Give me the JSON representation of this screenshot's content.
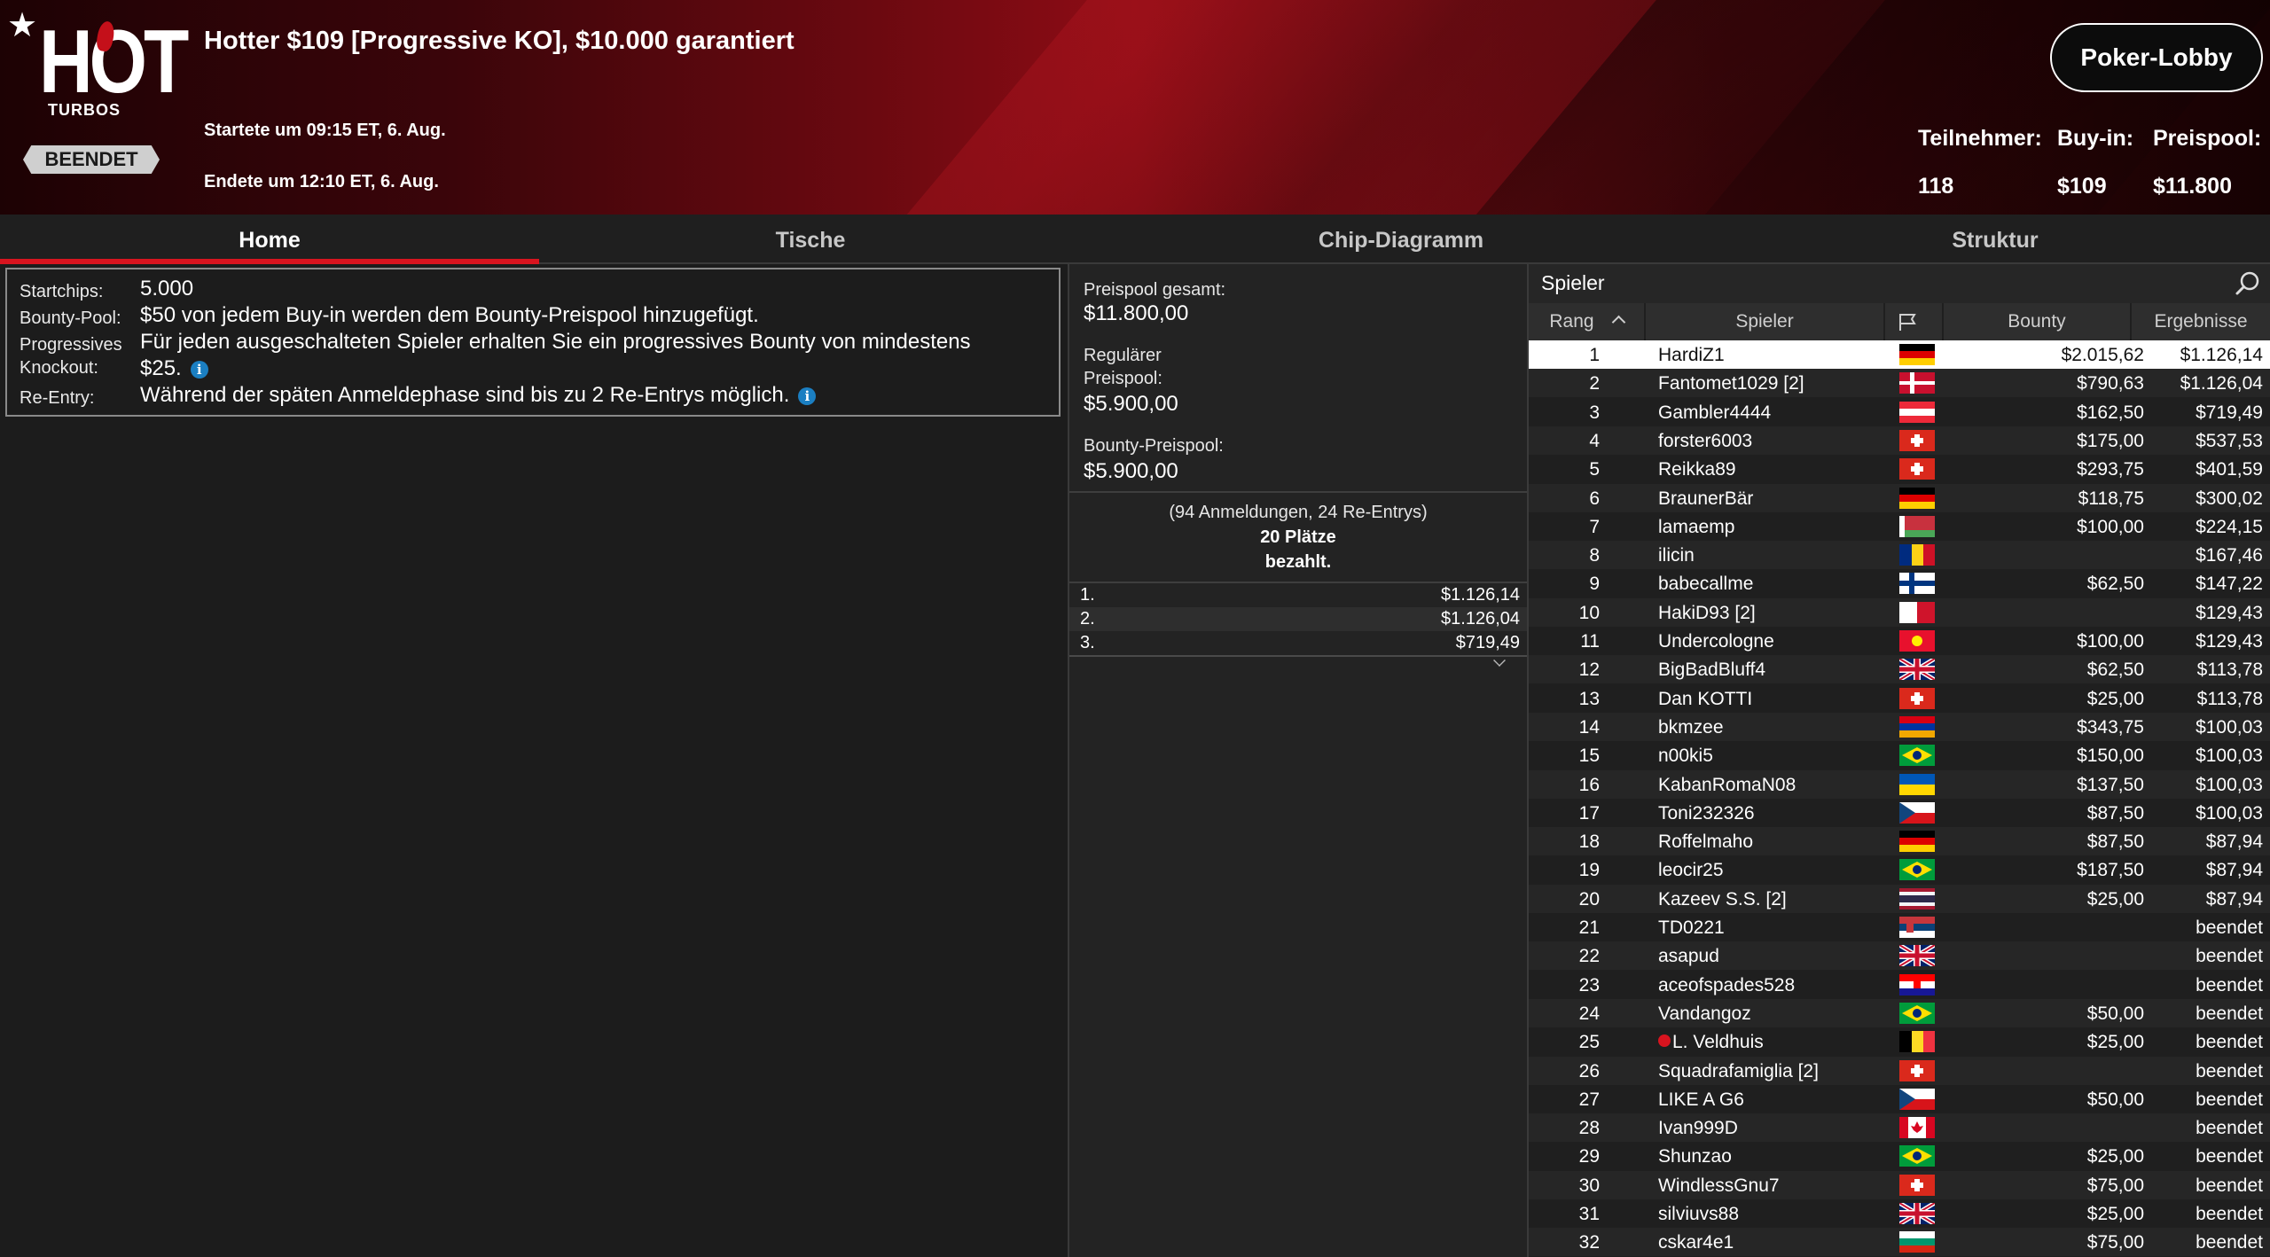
{
  "header": {
    "title": "Hotter $109 [Progressive KO], $10.000 garantiert",
    "started": "Startete um 09:15 ET, 6. Aug.",
    "ended": "Endete um 12:10 ET, 6. Aug.",
    "status": "BEENDET",
    "logo_text": "HOT",
    "logo_sub": "TURBOS",
    "lobby_button": "Poker-Lobby",
    "stats": {
      "participants_label": "Teilnehmer:",
      "participants_value": "118",
      "buyin_label": "Buy-in:",
      "buyin_value": "$109",
      "prizepool_label": "Preispool:",
      "prizepool_value": "$11.800"
    }
  },
  "tabs": [
    "Home",
    "Tische",
    "Chip-Diagramm",
    "Struktur"
  ],
  "active_tab": "Home",
  "info": {
    "startchips_label": "Startchips:",
    "startchips_value": "5.000",
    "bountypool_label": "Bounty-Pool:",
    "bountypool_value": "$50 von jedem Buy-in werden dem Bounty-Preispool hinzugefügt.",
    "pko_label_1": "Progressives",
    "pko_label_2": "Knockout:",
    "pko_value_1": "Für jeden ausgeschalteten Spieler erhalten Sie ein progressives Bounty von mindestens",
    "pko_value_2": "$25.",
    "reentry_label": "Re-Entry:",
    "reentry_value": "Während der späten Anmeldephase sind bis zu 2 Re-Entrys möglich."
  },
  "prizes": {
    "total_label": "Preispool gesamt:",
    "total_value": "$11.800,00",
    "regular_label_1": "Regulärer",
    "regular_label_2": "Preispool:",
    "regular_value": "$5.900,00",
    "bounty_label": "Bounty-Preispool:",
    "bounty_value": "$5.900,00",
    "registrations": "(94 Anmeldungen, 24 Re-Entrys)",
    "places_paid_1": "20 Plätze",
    "places_paid_2": "bezahlt.",
    "payouts": [
      {
        "pos": "1.",
        "amount": "$1.126,14"
      },
      {
        "pos": "2.",
        "amount": "$1.126,04"
      },
      {
        "pos": "3.",
        "amount": "$719,49"
      }
    ]
  },
  "players": {
    "title": "Spieler",
    "columns": [
      "Rang",
      "Spieler",
      "",
      "Bounty",
      "Ergebnisse"
    ],
    "rows": [
      {
        "rank": "1",
        "name": "HardiZ1",
        "flag": "de",
        "bounty": "$2.015,62",
        "result": "$1.126,14"
      },
      {
        "rank": "2",
        "name": "Fantomet1029 [2]",
        "flag": "dk",
        "bounty": "$790,63",
        "result": "$1.126,04"
      },
      {
        "rank": "3",
        "name": "Gambler4444",
        "flag": "at",
        "bounty": "$162,50",
        "result": "$719,49"
      },
      {
        "rank": "4",
        "name": "forster6003",
        "flag": "ch",
        "bounty": "$175,00",
        "result": "$537,53"
      },
      {
        "rank": "5",
        "name": "Reikka89",
        "flag": "ch",
        "bounty": "$293,75",
        "result": "$401,59"
      },
      {
        "rank": "6",
        "name": "BraunerBär",
        "flag": "de",
        "bounty": "$118,75",
        "result": "$300,02"
      },
      {
        "rank": "7",
        "name": "lamaemp",
        "flag": "by",
        "bounty": "$100,00",
        "result": "$224,15"
      },
      {
        "rank": "8",
        "name": "ilicin",
        "flag": "ro",
        "bounty": "",
        "result": "$167,46"
      },
      {
        "rank": "9",
        "name": "babecallme",
        "flag": "fi",
        "bounty": "$62,50",
        "result": "$147,22"
      },
      {
        "rank": "10",
        "name": "HakiD93 [2]",
        "flag": "mt",
        "bounty": "",
        "result": "$129,43"
      },
      {
        "rank": "11",
        "name": "Undercologne",
        "flag": "kg",
        "bounty": "$100,00",
        "result": "$129,43"
      },
      {
        "rank": "12",
        "name": "BigBadBluff4",
        "flag": "gb",
        "bounty": "$62,50",
        "result": "$113,78"
      },
      {
        "rank": "13",
        "name": "Dan KOTTI",
        "flag": "ch",
        "bounty": "$25,00",
        "result": "$113,78"
      },
      {
        "rank": "14",
        "name": "bkmzee",
        "flag": "am",
        "bounty": "$343,75",
        "result": "$100,03"
      },
      {
        "rank": "15",
        "name": "n00ki5",
        "flag": "br",
        "bounty": "$150,00",
        "result": "$100,03"
      },
      {
        "rank": "16",
        "name": "KabanRomaN08",
        "flag": "ua",
        "bounty": "$137,50",
        "result": "$100,03"
      },
      {
        "rank": "17",
        "name": "Toni232326",
        "flag": "cz",
        "bounty": "$87,50",
        "result": "$100,03"
      },
      {
        "rank": "18",
        "name": "Roffelmaho",
        "flag": "de",
        "bounty": "$87,50",
        "result": "$87,94"
      },
      {
        "rank": "19",
        "name": "leocir25",
        "flag": "br",
        "bounty": "$187,50",
        "result": "$87,94"
      },
      {
        "rank": "20",
        "name": "Kazeev S.S. [2]",
        "flag": "th",
        "bounty": "$25,00",
        "result": "$87,94"
      },
      {
        "rank": "21",
        "name": "TD0221",
        "flag": "rs",
        "bounty": "",
        "result": "beendet"
      },
      {
        "rank": "22",
        "name": "asapud",
        "flag": "gb",
        "bounty": "",
        "result": "beendet"
      },
      {
        "rank": "23",
        "name": "aceofspades528",
        "flag": "hr",
        "bounty": "",
        "result": "beendet"
      },
      {
        "rank": "24",
        "name": "Vandangoz",
        "flag": "br",
        "bounty": "$50,00",
        "result": "beendet"
      },
      {
        "rank": "25",
        "name": "L. Veldhuis",
        "flag": "be",
        "bounty": "$25,00",
        "result": "beendet",
        "pin": true
      },
      {
        "rank": "26",
        "name": "Squadrafamiglia [2]",
        "flag": "ch",
        "bounty": "",
        "result": "beendet"
      },
      {
        "rank": "27",
        "name": "LIKE A G6",
        "flag": "cz",
        "bounty": "$50,00",
        "result": "beendet"
      },
      {
        "rank": "28",
        "name": "Ivan999D",
        "flag": "ca",
        "bounty": "",
        "result": "beendet"
      },
      {
        "rank": "29",
        "name": "Shunzao",
        "flag": "br",
        "bounty": "$25,00",
        "result": "beendet"
      },
      {
        "rank": "30",
        "name": "WindlessGnu7",
        "flag": "ch",
        "bounty": "$75,00",
        "result": "beendet"
      },
      {
        "rank": "31",
        "name": "silviuvs88",
        "flag": "gb",
        "bounty": "$25,00",
        "result": "beendet"
      },
      {
        "rank": "32",
        "name": "cskar4e1",
        "flag": "bg",
        "bounty": "$75,00",
        "result": "beendet"
      }
    ]
  },
  "colors": {
    "accent_red": "#d8141f",
    "info_blue": "#1b7fc2",
    "panel_bg": "#1c1c1c"
  }
}
